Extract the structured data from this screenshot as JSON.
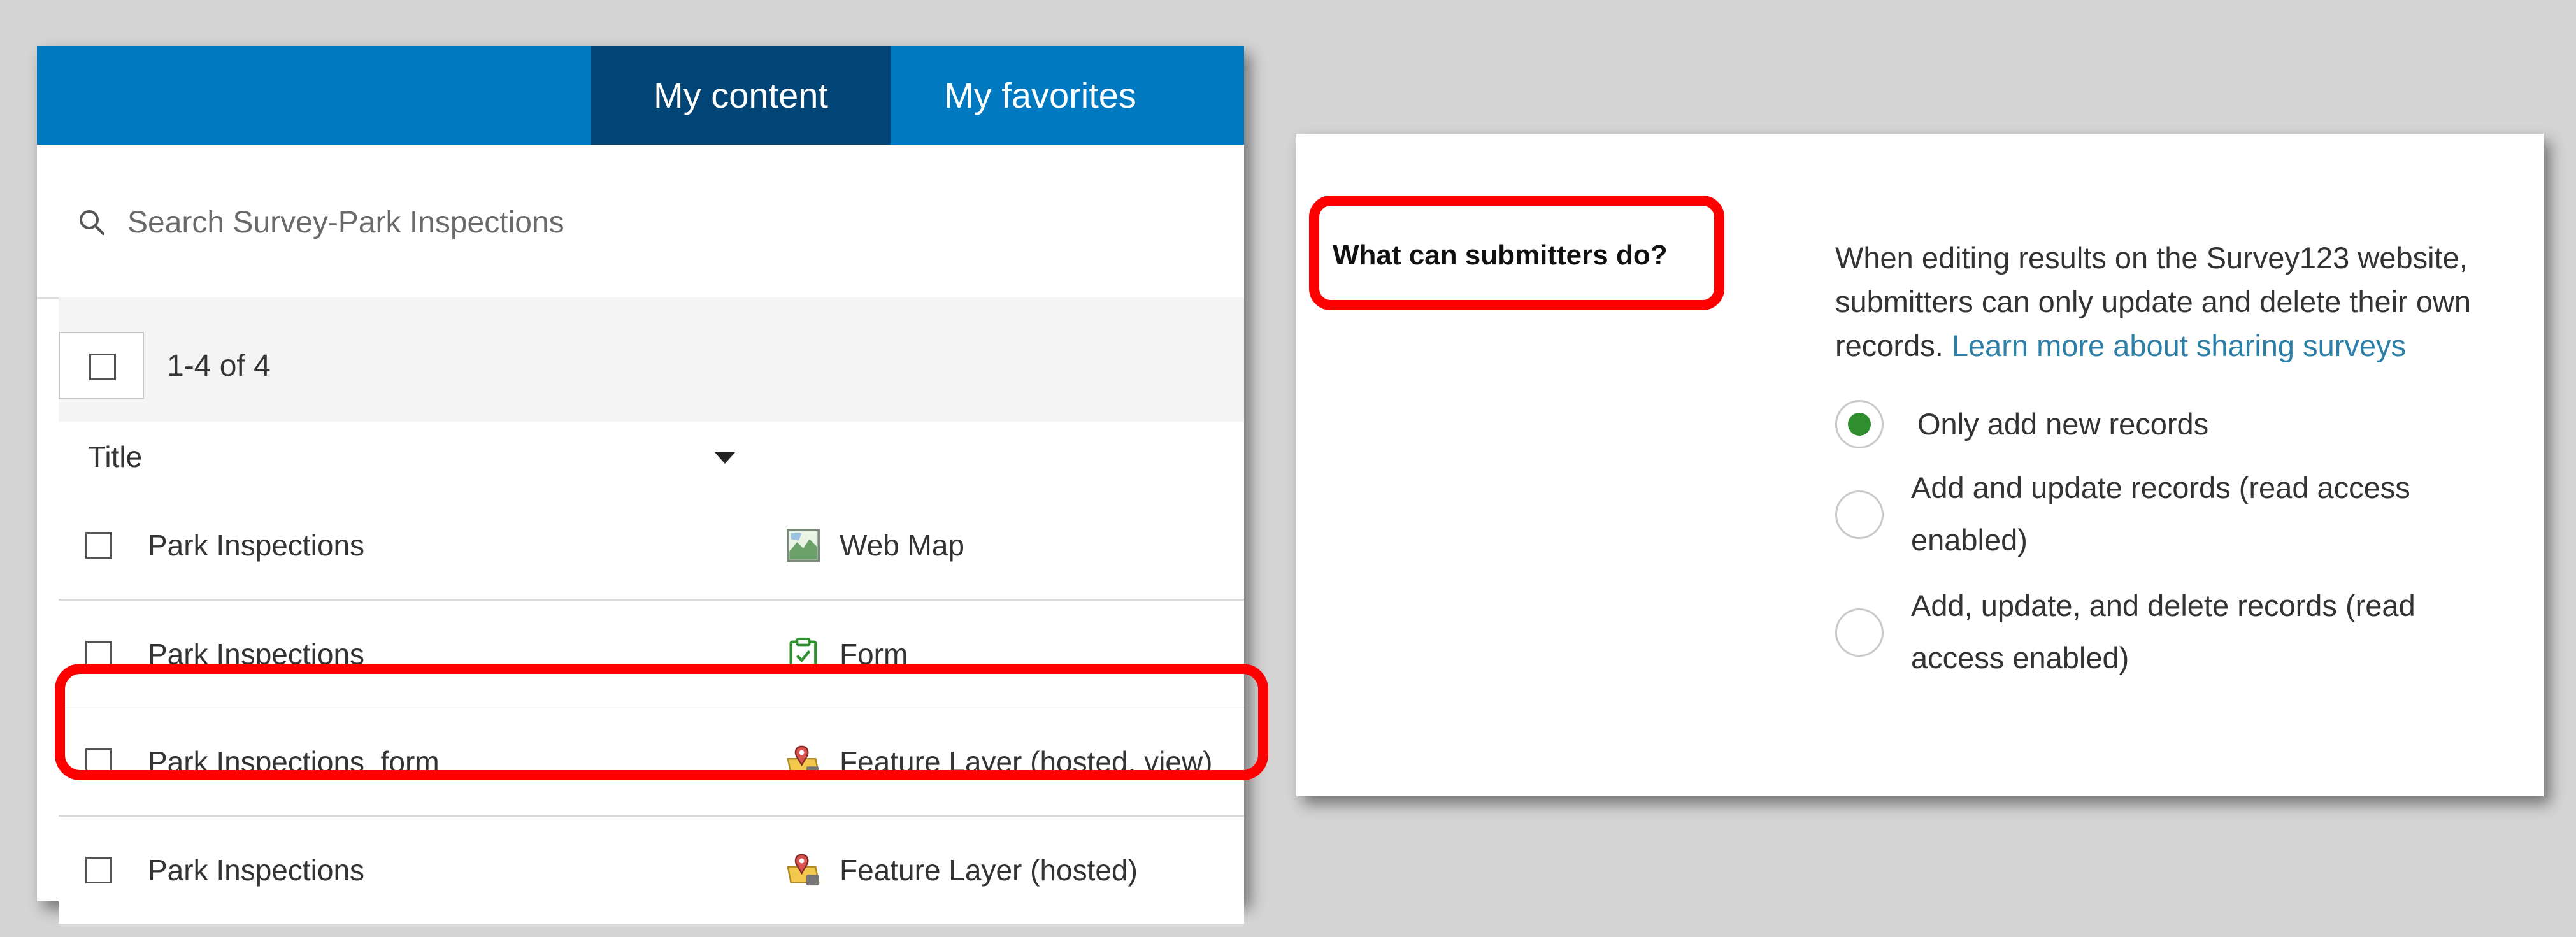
{
  "tabs": [
    {
      "label": "My content",
      "active": true
    },
    {
      "label": "My favorites",
      "active": false
    }
  ],
  "search": {
    "placeholder": "Search Survey-Park Inspections"
  },
  "list": {
    "count": "1-4 of 4",
    "column_header": "Title",
    "items": [
      {
        "title": "Park Inspections",
        "type": "Web Map",
        "icon": "web-map-icon"
      },
      {
        "title": "Park Inspections",
        "type": "Form",
        "icon": "form-icon"
      },
      {
        "title": "Park Inspections_form",
        "type": "Feature Layer (hosted, view)",
        "icon": "feature-layer-icon",
        "highlighted": true
      },
      {
        "title": "Park Inspections",
        "type": "Feature Layer (hosted)",
        "icon": "feature-layer-icon"
      }
    ]
  },
  "settings": {
    "question": "What can submitters do?",
    "description": "When editing results on the Survey123 website, submitters can only update and delete their own records.",
    "link": "Learn more about sharing surveys",
    "options": [
      {
        "label": "Only add new records",
        "selected": true
      },
      {
        "label": "Add and update records (read access enabled)",
        "selected": false
      },
      {
        "label": "Add, update, and delete records (read access enabled)",
        "selected": false
      }
    ]
  },
  "colors": {
    "tabbar": "#0079c1",
    "active_tab": "#004575",
    "highlight": "#ff0000",
    "radio_selected": "#2f8f2f",
    "link": "#2a7fa8"
  }
}
